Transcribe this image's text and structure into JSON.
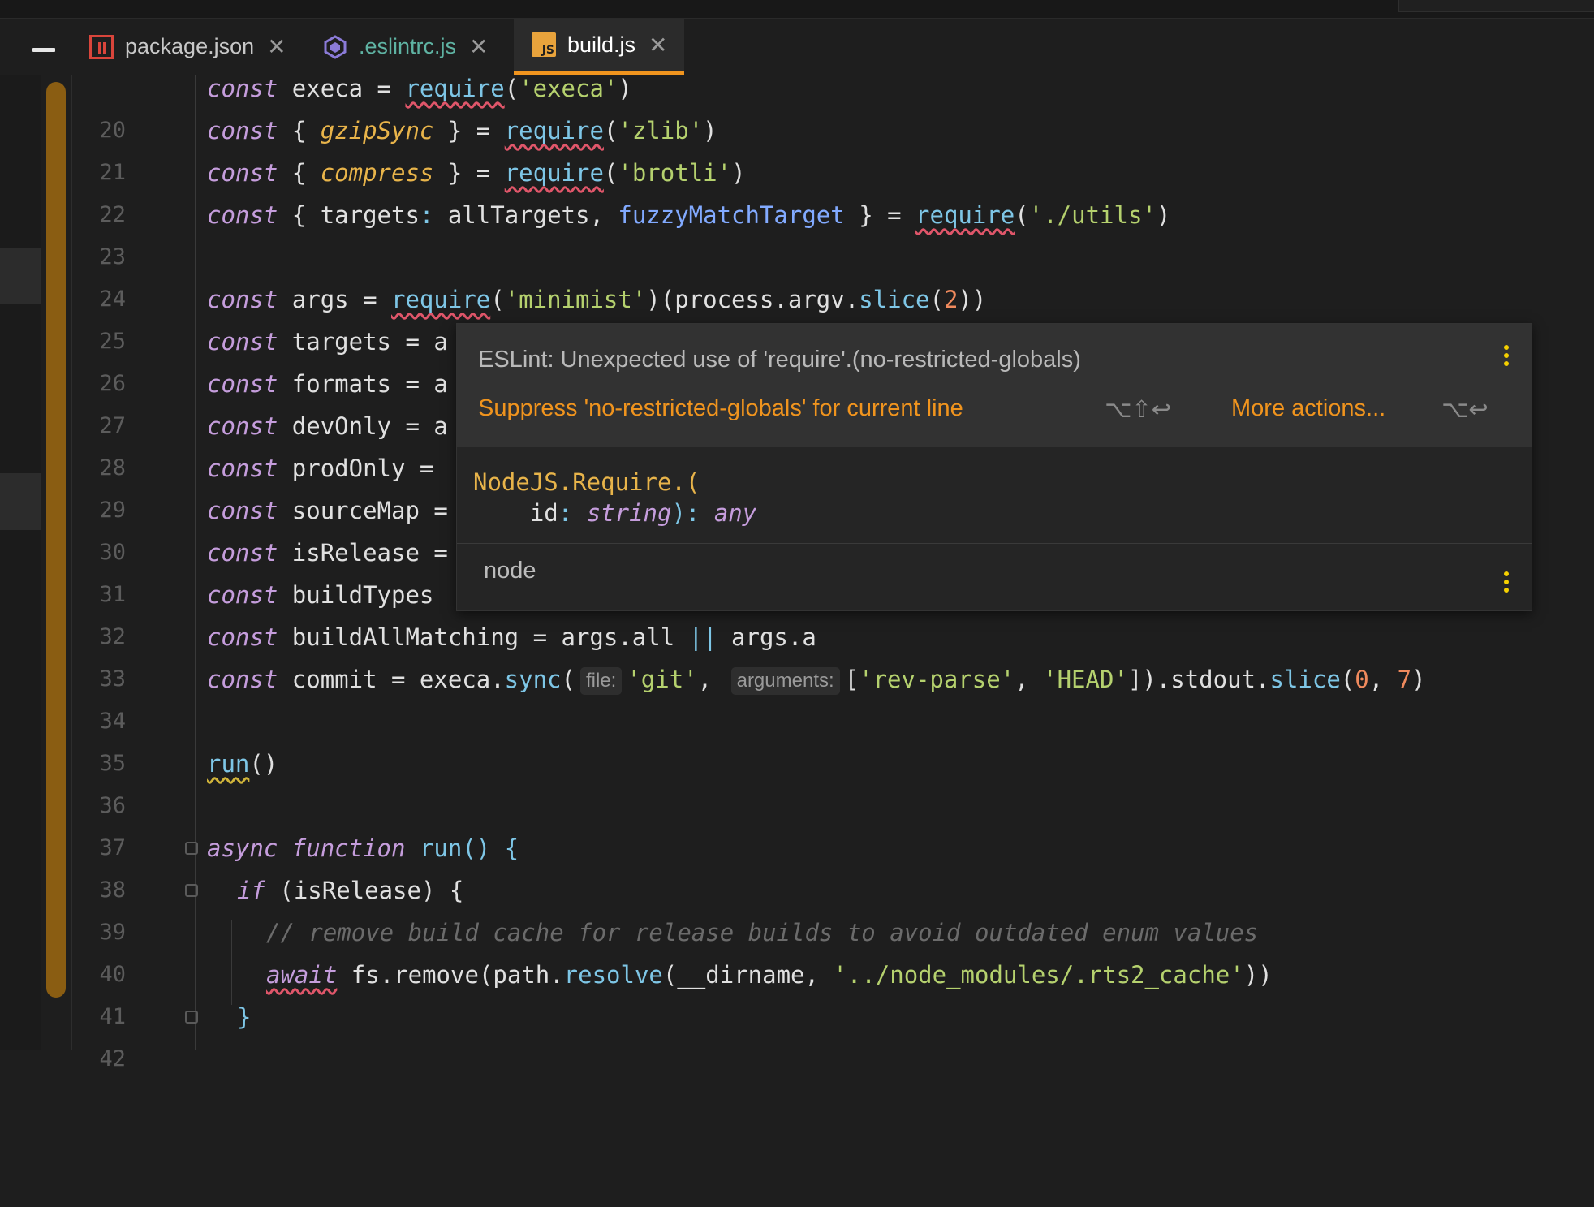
{
  "tabs": [
    {
      "label": "package.json",
      "icon": "npm-package-icon",
      "color": "#c8c8c8",
      "active": false
    },
    {
      "label": ".eslintrc.js",
      "icon": "eslint-icon",
      "color": "#5fb3a3",
      "active": false
    },
    {
      "label": "build.js",
      "icon": "javascript-file-icon",
      "color": "#ffffff",
      "active": true
    }
  ],
  "tab_close_glyph": "✕",
  "accent_color": "#f0941e",
  "lines": {
    "l20": {
      "n": "20",
      "kw": "const",
      "name": " execa = ",
      "req": "require",
      "open": "(",
      "str": "'execa'",
      "close": ")"
    },
    "l21": {
      "n": "21",
      "kw": "const",
      "b1": " { ",
      "it": "gzipSync",
      "b2": " } = ",
      "req": "require",
      "open": "(",
      "str": "'zlib'",
      "close": ")"
    },
    "l22": {
      "n": "22",
      "kw": "const",
      "b1": " { ",
      "it": "compress",
      "b2": " } = ",
      "req": "require",
      "open": "(",
      "str": "'brotli'",
      "close": ")"
    },
    "l23": {
      "n": "23",
      "kw": "const",
      "b1": " { targets",
      "colon": ":",
      "b2": " allTargets, ",
      "prop": "fuzzyMatchTarget",
      "b3": " } = ",
      "req": "require",
      "open": "(",
      "str": "'./utils'",
      "close": ")"
    },
    "l24": {
      "n": "24"
    },
    "l25": {
      "n": "25",
      "kw": "const",
      "name": " args = ",
      "req": "require",
      "open": "(",
      "str": "'minimist'",
      "mid": ")(process.argv.",
      "fn": "slice",
      "open2": "(",
      "num": "2",
      "close": "))"
    },
    "l26": {
      "n": "26",
      "kw": "const",
      "rest": " targets = a"
    },
    "l27": {
      "n": "27",
      "kw": "const",
      "rest": " formats = a"
    },
    "l28": {
      "n": "28",
      "kw": "const",
      "rest": " devOnly = a"
    },
    "l29": {
      "n": "29",
      "kw": "const",
      "rest": " prodOnly = "
    },
    "l30": {
      "n": "30",
      "kw": "const",
      "rest": " sourceMap = "
    },
    "l31": {
      "n": "31",
      "kw": "const",
      "rest": " isRelease = "
    },
    "l32": {
      "n": "32",
      "kw": "const",
      "rest": " buildTypes "
    },
    "l33": {
      "n": "33",
      "kw": "const",
      "rest": " buildAllMatching = args.all ",
      "op": "||",
      "rest2": " args.a"
    },
    "l34": {
      "n": "34",
      "kw": "const",
      "name": " commit = execa.",
      "fn": "sync",
      "open": "(",
      "hint1": "file:",
      "str1": "'git'",
      "comma": ",",
      "hint2": "arguments:",
      "arr_open": "[",
      "str2": "'rev-parse'",
      "comma2": ", ",
      "str3": "'HEAD'",
      "arr_close": "]).stdout.",
      "fn2": "slice",
      "open2": "(",
      "num1": "0",
      "comma3": ", ",
      "num2": "7",
      "close": ")"
    },
    "l35": {
      "n": "35"
    },
    "l36": {
      "n": "36",
      "call": "run",
      "parens": "()"
    },
    "l37": {
      "n": "37"
    },
    "l38": {
      "n": "38",
      "kw1": "async",
      "kw2": "function",
      "fn": "run",
      "rest": "() {"
    },
    "l39": {
      "n": "39",
      "kw": "if",
      "rest": " (isRelease) {"
    },
    "l40": {
      "n": "40",
      "comment": "// remove build cache for release builds to avoid outdated enum values"
    },
    "l41": {
      "n": "41",
      "kw": "await",
      "mid": " fs.remove(path.",
      "fn": "resolve",
      "rest": "(__dirname, ",
      "str": "'../node_modules/.rts2_cache'",
      "close": "))"
    },
    "l42": {
      "n": "42",
      "rest": "}"
    }
  },
  "popup": {
    "message": "ESLint: Unexpected use of 'require'.(no-restricted-globals)",
    "fix_action": "Suppress 'no-restricted-globals' for current line",
    "fix_shortcut": "⌥⇧↩",
    "more_action": "More actions...",
    "more_shortcut": "⌥↩",
    "signature_type": "NodeJS.Require.(",
    "signature_param": "id",
    "signature_param_type": "string",
    "signature_return": "any",
    "module": "node"
  }
}
